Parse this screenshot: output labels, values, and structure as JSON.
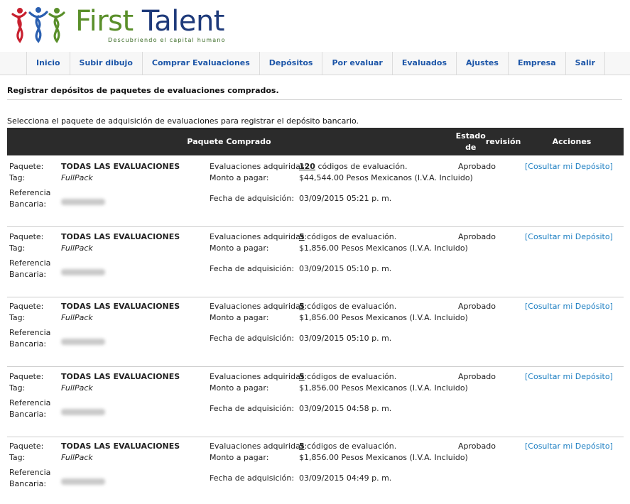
{
  "brand": {
    "name_part1": "First",
    "name_part2_initial": "T",
    "name_part2_rest": "alent",
    "tagline": "Descubriendo el capital humano",
    "colors": {
      "green": "#5a8f2a",
      "navy": "#1e3a7a",
      "red": "#c8202f",
      "blue": "#2a5fb0"
    }
  },
  "nav": {
    "items": [
      {
        "label": "Inicio"
      },
      {
        "label": "Subir dibujo"
      },
      {
        "label": "Comprar Evaluaciones"
      },
      {
        "label": "Depósitos"
      },
      {
        "label": "Por evaluar"
      },
      {
        "label": "Evaluados"
      },
      {
        "label": "Ajustes"
      },
      {
        "label": "Empresa"
      },
      {
        "label": "Salir"
      }
    ]
  },
  "page": {
    "title": "Registrar depósitos de paquetes de evaluaciones comprados.",
    "instruction": "Selecciona el paquete de adquisición de evaluaciones para registrar el depósito bancario."
  },
  "table": {
    "headers": {
      "paquete": "Paquete Comprado",
      "estado_line1": "Estado de",
      "estado_line2": "revisión",
      "acciones": "Acciones"
    },
    "labels": {
      "paquete": "Paquete:",
      "tag": "Tag:",
      "referencia": "Referencia",
      "bancaria": "Bancaria:",
      "evals": "Evaluaciones adquiridas:",
      "monto": "Monto a pagar:",
      "fecha": "Fecha de adquisición:",
      "codes_suffix": " códigos de evaluación."
    },
    "rows": [
      {
        "paquete": "TODAS LAS EVALUACIONES",
        "tag": "FullPack",
        "evals": "120",
        "monto": "$44,544.00 Pesos Mexicanos (I.V.A. Incluido)",
        "fecha": "03/09/2015 05:21 p. m.",
        "estado": "Aprobado",
        "accion": "[Cosultar mi Depósito]"
      },
      {
        "paquete": "TODAS LAS EVALUACIONES",
        "tag": "FullPack",
        "evals": "5",
        "monto": "$1,856.00 Pesos Mexicanos (I.V.A. Incluido)",
        "fecha": "03/09/2015 05:10 p. m.",
        "estado": "Aprobado",
        "accion": "[Cosultar mi Depósito]"
      },
      {
        "paquete": "TODAS LAS EVALUACIONES",
        "tag": "FullPack",
        "evals": "5",
        "monto": "$1,856.00 Pesos Mexicanos (I.V.A. Incluido)",
        "fecha": "03/09/2015 05:10 p. m.",
        "estado": "Aprobado",
        "accion": "[Cosultar mi Depósito]"
      },
      {
        "paquete": "TODAS LAS EVALUACIONES",
        "tag": "FullPack",
        "evals": "5",
        "monto": "$1,856.00 Pesos Mexicanos (I.V.A. Incluido)",
        "fecha": "03/09/2015 04:58 p. m.",
        "estado": "Aprobado",
        "accion": "[Cosultar mi Depósito]"
      },
      {
        "paquete": "TODAS LAS EVALUACIONES",
        "tag": "FullPack",
        "evals": "5",
        "monto": "$1,856.00 Pesos Mexicanos (I.V.A. Incluido)",
        "fecha": "03/09/2015 04:49 p. m.",
        "estado": "Aprobado",
        "accion": "[Cosultar mi Depósito]"
      }
    ]
  }
}
